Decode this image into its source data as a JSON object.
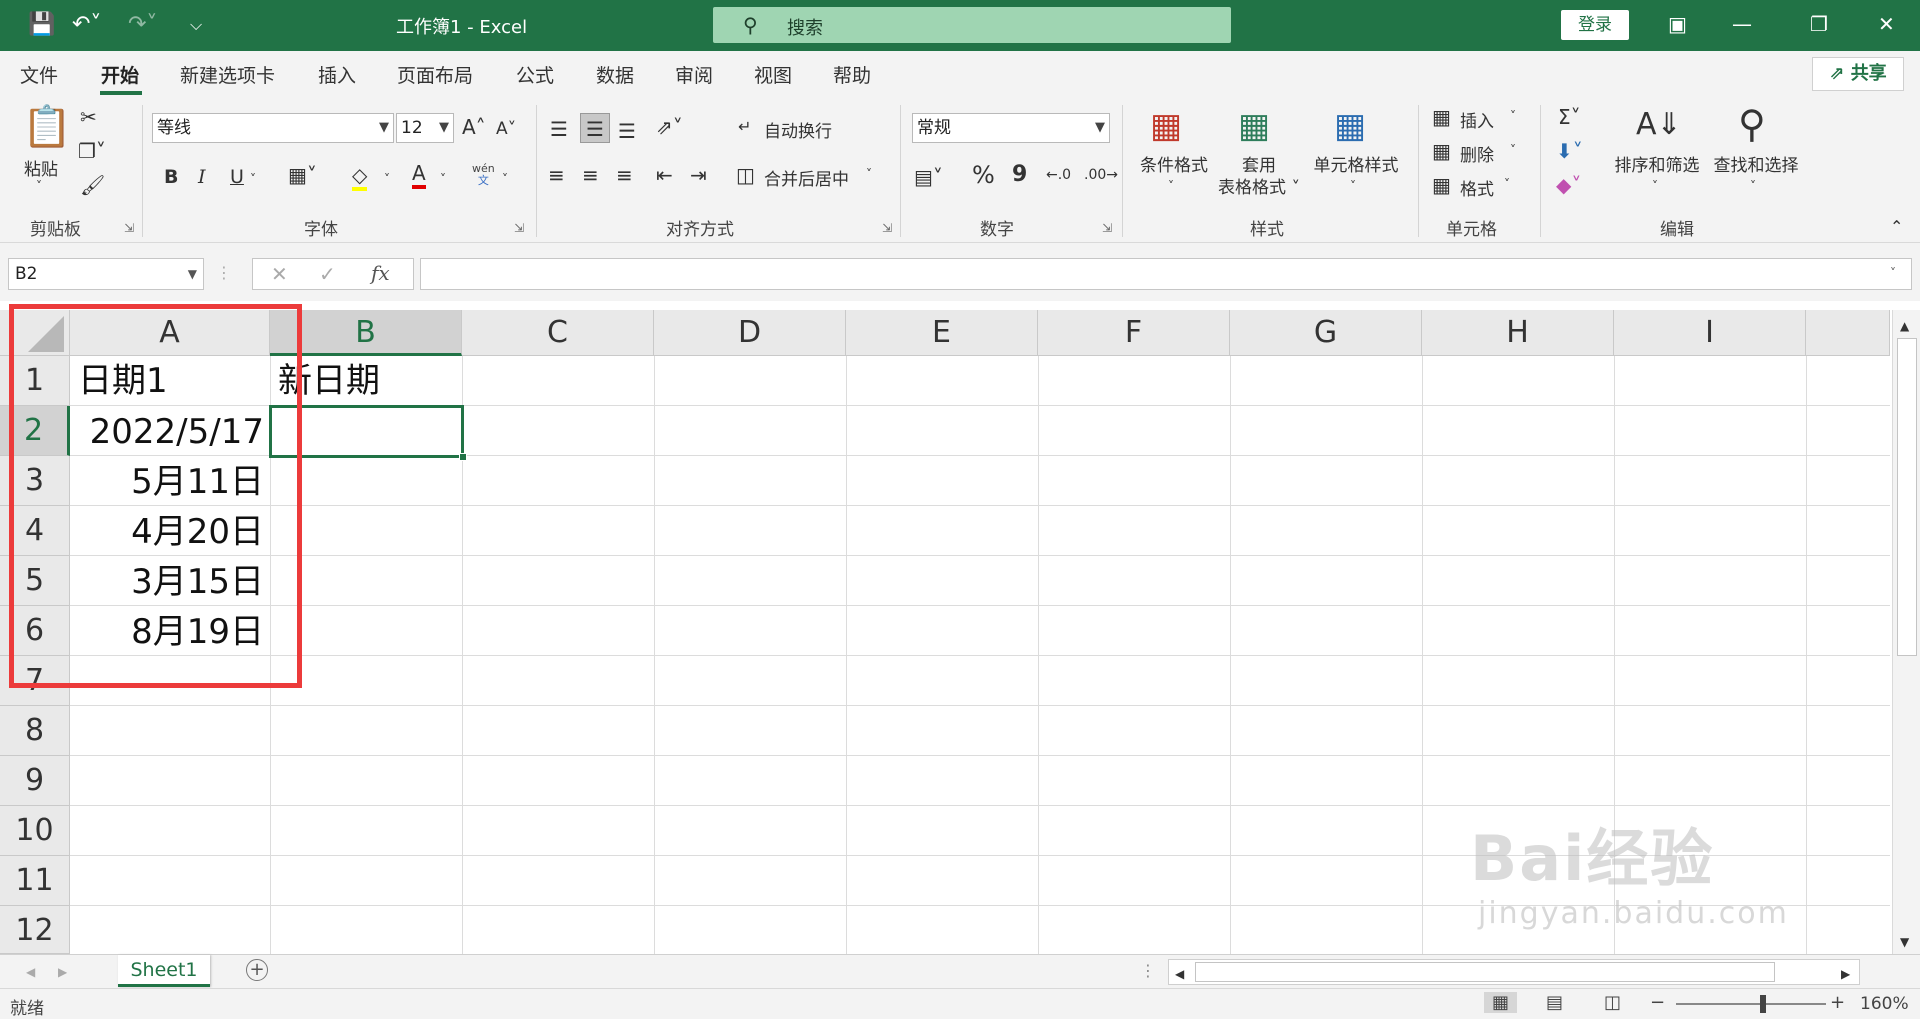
{
  "titlebar": {
    "title": "工作簿1  -  Excel",
    "search_placeholder": "搜索",
    "login_label": "登录"
  },
  "menu": {
    "items": [
      "文件",
      "开始",
      "新建选项卡",
      "插入",
      "页面布局",
      "公式",
      "数据",
      "审阅",
      "视图",
      "帮助"
    ],
    "active": "开始",
    "share_label": "共享"
  },
  "ribbon": {
    "clipboard": {
      "paste_label": "粘贴",
      "group_label": "剪贴板"
    },
    "font": {
      "font_name": "等线",
      "font_size": "12",
      "group_label": "字体",
      "bold": "B",
      "italic": "I",
      "underline": "U",
      "phonetic_top": "wén",
      "phonetic_bottom": "文"
    },
    "alignment": {
      "wrap_label": "自动换行",
      "merge_label": "合并后居中",
      "group_label": "对齐方式"
    },
    "number": {
      "format": "常规",
      "percent": "%",
      "comma": "9",
      "group_label": "数字"
    },
    "styles": {
      "conditional_label": "条件格式",
      "table_label_1": "套用",
      "table_label_2": "表格格式",
      "cell_style_label": "单元格样式",
      "group_label": "样式"
    },
    "cells": {
      "insert_label": "插入",
      "delete_label": "删除",
      "format_label": "格式",
      "group_label": "单元格"
    },
    "editing": {
      "sort_label": "排序和筛选",
      "find_label": "查找和选择",
      "group_label": "编辑"
    }
  },
  "formula_bar": {
    "name_box": "B2",
    "fx": "fx",
    "value": ""
  },
  "grid": {
    "columns": [
      "A",
      "B",
      "C",
      "D",
      "E",
      "F",
      "G",
      "H",
      "I"
    ],
    "rows": [
      "1",
      "2",
      "3",
      "4",
      "5",
      "6",
      "7",
      "8",
      "9",
      "10",
      "11",
      "12"
    ],
    "selected_column": "B",
    "selected_row": "2",
    "cells": {
      "A1": "日期1",
      "B1": "新日期",
      "A2": "2022/5/17",
      "A3": "5月11日",
      "A4": "4月20日",
      "A5": "3月15日",
      "A6": "8月19日"
    }
  },
  "sheets": {
    "tabs": [
      "Sheet1"
    ],
    "active": "Sheet1"
  },
  "status": {
    "text": "就绪",
    "zoom": "160%"
  },
  "watermark": {
    "main": "Bai经验",
    "sub": "jingyan.baidu.com"
  },
  "colors": {
    "excel_green": "#217346",
    "highlight_red": "#ec3b3b"
  }
}
